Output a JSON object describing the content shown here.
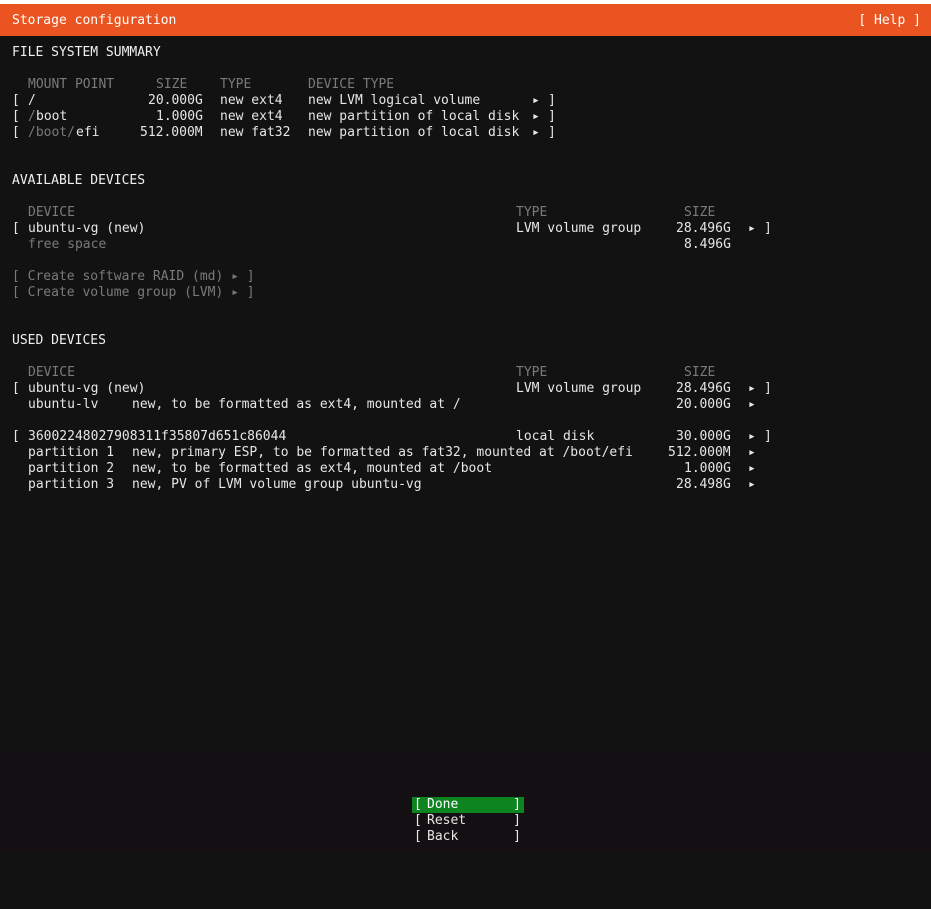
{
  "window": {
    "title": "Storage configuration",
    "help": "[ Help ]"
  },
  "fs_summary": {
    "heading": "FILE SYSTEM SUMMARY",
    "columns": {
      "mount": "MOUNT POINT",
      "size": "SIZE",
      "type": "TYPE",
      "device_type": "DEVICE TYPE"
    },
    "rows": [
      {
        "mount_dim": "",
        "mount": "/",
        "size": "20.000G",
        "type": "new ext4",
        "device_type": "new LVM logical volume"
      },
      {
        "mount_dim": "/",
        "mount": "boot",
        "size": "1.000G",
        "type": "new ext4",
        "device_type": "new partition of local disk"
      },
      {
        "mount_dim": "/boot/",
        "mount": "efi",
        "size": "512.000M",
        "type": "new fat32",
        "device_type": "new partition of local disk"
      }
    ]
  },
  "available": {
    "heading": "AVAILABLE DEVICES",
    "columns": {
      "device": "DEVICE",
      "type": "TYPE",
      "size": "SIZE"
    },
    "vg": {
      "name": "ubuntu-vg (new)",
      "type": "LVM volume group",
      "size": "28.496G"
    },
    "free": {
      "label": "free space",
      "size": "8.496G"
    },
    "actions": [
      "[ Create software RAID (md) ▸ ]",
      "[ Create volume group (LVM) ▸ ]"
    ]
  },
  "used": {
    "heading": "USED DEVICES",
    "columns": {
      "device": "DEVICE",
      "type": "TYPE",
      "size": "SIZE"
    },
    "vg": {
      "name": "ubuntu-vg (new)",
      "type": "LVM volume group",
      "size": "28.496G"
    },
    "lv": {
      "name": "ubuntu-lv",
      "desc": "new, to be formatted as ext4, mounted at /",
      "size": "20.000G"
    },
    "disk": {
      "name": "36002248027908311f35807d651c86044",
      "type": "local disk",
      "size": "30.000G"
    },
    "partitions": [
      {
        "name": "partition 1",
        "desc": "new, primary ESP, to be formatted as fat32, mounted at /boot/efi",
        "size": "512.000M"
      },
      {
        "name": "partition 2",
        "desc": "new, to be formatted as ext4, mounted at /boot",
        "size": "1.000G"
      },
      {
        "name": "partition 3",
        "desc": "new, PV of LVM volume group ubuntu-vg",
        "size": "28.498G"
      }
    ]
  },
  "symbols": {
    "open_bracket": "[",
    "close_bracket": "]",
    "arrow": "▸"
  },
  "buttons": {
    "done": "Done",
    "reset": "Reset",
    "back": "Back"
  },
  "colors": {
    "accent": "#e95420",
    "done_bg": "#0e8420",
    "background": "#121212"
  }
}
